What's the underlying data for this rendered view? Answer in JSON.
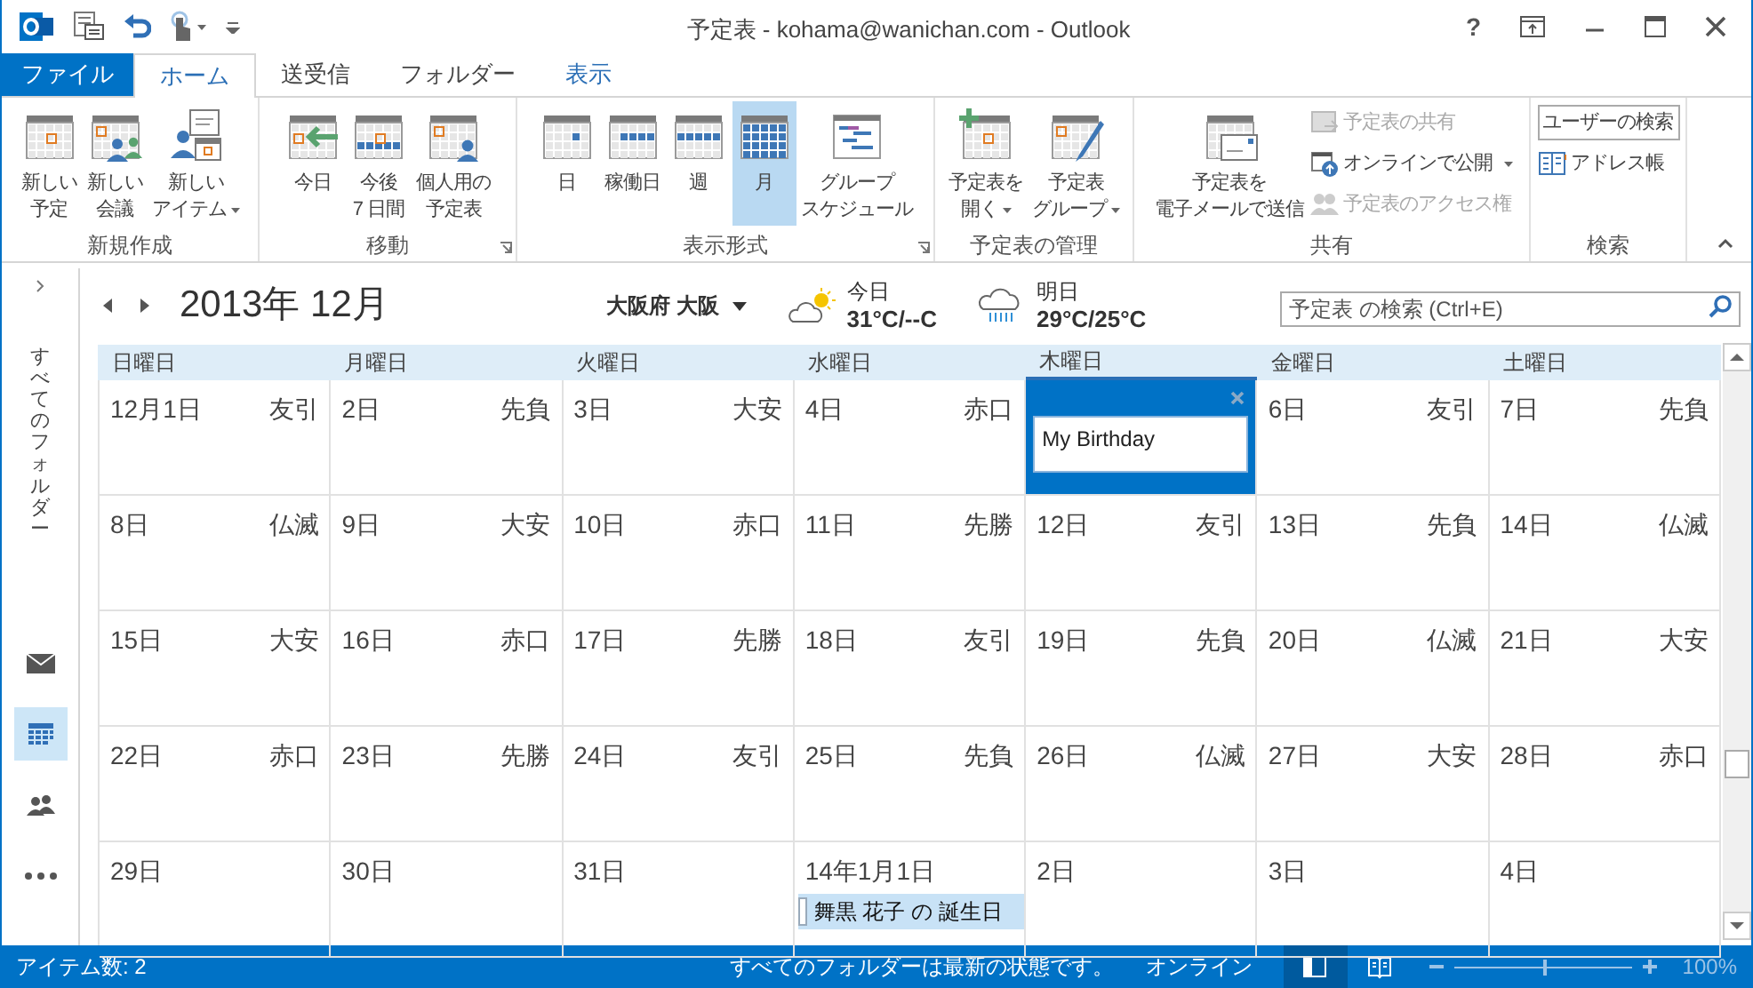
{
  "window": {
    "title": "予定表 - kohama@wanichan.com - Outlook",
    "help": "?"
  },
  "ribbon_tabs": [
    {
      "label": "ファイル",
      "kind": "file",
      "selected": false,
      "highlighted": false
    },
    {
      "label": "ホーム",
      "kind": "tab",
      "selected": true,
      "highlighted": false
    },
    {
      "label": "送受信",
      "kind": "tab",
      "selected": false,
      "highlighted": false
    },
    {
      "label": "フォルダー",
      "kind": "tab",
      "selected": false,
      "highlighted": false
    },
    {
      "label": "表示",
      "kind": "tab",
      "selected": false,
      "highlighted": true
    }
  ],
  "ribbon_groups": [
    {
      "label": "新規作成",
      "buttons": [
        {
          "kind": "large",
          "lines": [
            "新しい",
            "予定"
          ]
        },
        {
          "kind": "large",
          "lines": [
            "新しい",
            "会議"
          ]
        },
        {
          "kind": "large",
          "lines": [
            "新しい",
            "アイテム"
          ],
          "dropdown": true
        }
      ]
    },
    {
      "label": "移動",
      "launcher": true,
      "buttons": [
        {
          "kind": "large",
          "lines": [
            "今日"
          ]
        },
        {
          "kind": "large",
          "lines": [
            "今後",
            "7 日間"
          ]
        },
        {
          "kind": "large",
          "lines": [
            "個人用の",
            "予定表"
          ]
        }
      ]
    },
    {
      "label": "表示形式",
      "launcher": true,
      "buttons": [
        {
          "kind": "large",
          "lines": [
            "日"
          ],
          "selected": false
        },
        {
          "kind": "large",
          "lines": [
            "稼働日"
          ],
          "selected": false
        },
        {
          "kind": "large",
          "lines": [
            "週"
          ],
          "selected": false
        },
        {
          "kind": "large",
          "lines": [
            "月"
          ],
          "selected": true
        },
        {
          "kind": "large",
          "lines": [
            "グループ",
            "スケジュール"
          ],
          "selected": false
        }
      ]
    },
    {
      "label": "予定表の管理",
      "buttons": [
        {
          "kind": "large",
          "lines": [
            "予定表を",
            "開く"
          ],
          "dropdown": true
        },
        {
          "kind": "large",
          "lines": [
            "予定表",
            "グループ"
          ],
          "dropdown": true
        }
      ]
    },
    {
      "label": "共有",
      "buttons": [
        {
          "kind": "large",
          "lines": [
            "予定表を",
            "電子メールで送信"
          ],
          "disabled": false
        },
        {
          "kind": "small",
          "lines": [
            "予定表の共有"
          ],
          "disabled": true
        },
        {
          "kind": "small",
          "lines": [
            "オンラインで公開"
          ],
          "dropdown": true,
          "disabled": false
        },
        {
          "kind": "small",
          "lines": [
            "予定表のアクセス権"
          ],
          "disabled": true
        }
      ]
    },
    {
      "label": "検索",
      "buttons": [
        {
          "kind": "field",
          "placeholder": "ユーザーの検索"
        },
        {
          "kind": "small",
          "lines": [
            "アドレス帳"
          ]
        }
      ]
    }
  ],
  "navigation": {
    "folder_label": "すべてのフォルダー",
    "items": [
      {
        "kind": "mail",
        "selected": false
      },
      {
        "kind": "calendar",
        "selected": true
      },
      {
        "kind": "people",
        "selected": false
      },
      {
        "kind": "more",
        "selected": false
      }
    ]
  },
  "calendar": {
    "month": "2013年 12月",
    "location": "大阪府 大阪",
    "weather": [
      {
        "kind": "partly_sunny",
        "day": "今日",
        "temps": "31°C/--C"
      },
      {
        "kind": "rain",
        "day": "明日",
        "temps": "29°C/25°C"
      }
    ],
    "search": {
      "placeholder": "予定表 の検索 (Ctrl+E)"
    },
    "weekdays": [
      {
        "label": "日曜日",
        "today": false
      },
      {
        "label": "月曜日",
        "today": false
      },
      {
        "label": "火曜日",
        "today": false
      },
      {
        "label": "水曜日",
        "today": false
      },
      {
        "label": "木曜日",
        "today": true
      },
      {
        "label": "金曜日",
        "today": false
      },
      {
        "label": "土曜日",
        "today": false
      }
    ],
    "weeks": [
      [
        {
          "date": "12月1日",
          "rokuyo": "友引",
          "selected": false
        },
        {
          "date": "2日",
          "rokuyo": "先負",
          "selected": false
        },
        {
          "date": "3日",
          "rokuyo": "大安",
          "selected": false
        },
        {
          "date": "4日",
          "rokuyo": "赤口",
          "selected": false
        },
        {
          "selected": true,
          "editor": "My Birthday"
        },
        {
          "date": "6日",
          "rokuyo": "友引",
          "selected": false
        },
        {
          "date": "7日",
          "rokuyo": "先負",
          "selected": false
        }
      ],
      [
        {
          "date": "8日",
          "rokuyo": "仏滅",
          "selected": false
        },
        {
          "date": "9日",
          "rokuyo": "大安",
          "selected": false
        },
        {
          "date": "10日",
          "rokuyo": "赤口",
          "selected": false
        },
        {
          "date": "11日",
          "rokuyo": "先勝",
          "selected": false
        },
        {
          "date": "12日",
          "rokuyo": "友引",
          "selected": false
        },
        {
          "date": "13日",
          "rokuyo": "先負",
          "selected": false
        },
        {
          "date": "14日",
          "rokuyo": "仏滅",
          "selected": false
        }
      ],
      [
        {
          "date": "15日",
          "rokuyo": "大安",
          "selected": false
        },
        {
          "date": "16日",
          "rokuyo": "赤口",
          "selected": false
        },
        {
          "date": "17日",
          "rokuyo": "先勝",
          "selected": false
        },
        {
          "date": "18日",
          "rokuyo": "友引",
          "selected": false
        },
        {
          "date": "19日",
          "rokuyo": "先負",
          "selected": false
        },
        {
          "date": "20日",
          "rokuyo": "仏滅",
          "selected": false
        },
        {
          "date": "21日",
          "rokuyo": "大安",
          "selected": false
        }
      ],
      [
        {
          "date": "22日",
          "rokuyo": "赤口",
          "selected": false
        },
        {
          "date": "23日",
          "rokuyo": "先勝",
          "selected": false
        },
        {
          "date": "24日",
          "rokuyo": "友引",
          "selected": false
        },
        {
          "date": "25日",
          "rokuyo": "先負",
          "selected": false
        },
        {
          "date": "26日",
          "rokuyo": "仏滅",
          "selected": false
        },
        {
          "date": "27日",
          "rokuyo": "大安",
          "selected": false
        },
        {
          "date": "28日",
          "rokuyo": "赤口",
          "selected": false
        }
      ],
      [
        {
          "date": "29日",
          "selected": false
        },
        {
          "date": "30日",
          "selected": false
        },
        {
          "date": "31日",
          "selected": false
        },
        {
          "date": "14年1月1日",
          "selected": false,
          "events": [
            "舞黒 花子 の 誕生日"
          ]
        },
        {
          "date": "2日",
          "selected": false
        },
        {
          "date": "3日",
          "selected": false
        },
        {
          "date": "4日",
          "selected": false
        }
      ]
    ]
  },
  "status_bar": {
    "items": "アイテム数: 2",
    "sync": "すべてのフォルダーは最新の状態です。",
    "connection": "オンライン",
    "views": [
      {
        "kind": "normal",
        "selected": true
      },
      {
        "kind": "reading",
        "selected": false
      }
    ],
    "zoom": {
      "level": 0.5,
      "label": "100%"
    }
  }
}
